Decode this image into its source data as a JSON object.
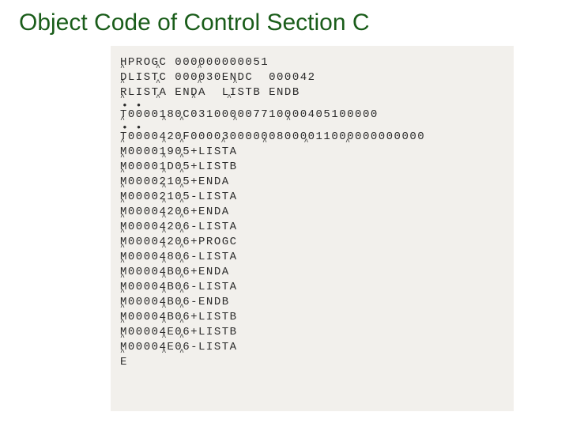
{
  "title": "Object Code of Control Section C",
  "lines": {
    "l1": {
      "text": "HPROGC 000000000051",
      "caret": "^     ^      ^"
    },
    "l2": {
      "text": "DLISTC 000030ENDC  000042",
      "caret": "^     ^      ^     ^"
    },
    "l3": {
      "text": "RLISTA ENDA  LISTB ENDB",
      "caret": "^     ^     ^     ^"
    },
    "l4": {
      "text": "T0000180C031000007710000405100000",
      "caret": "^      ^  ^        ^        ^"
    },
    "l5": {
      "text": "T0000420F000030000008000011000000000000",
      "caret": "^      ^  ^      ^      ^      ^      ^"
    },
    "l6": {
      "text": "M00001905+LISTA",
      "caret": "^      ^  ^"
    },
    "l7": {
      "text": "M00001D05+LISTB",
      "caret": "^      ^  ^"
    },
    "l8": {
      "text": "M00002105+ENDA",
      "caret": "^      ^  ^"
    },
    "l9": {
      "text": "M00002105-LISTA",
      "caret": "^      ^  ^"
    },
    "l10": {
      "text": "M00004206+ENDA",
      "caret": "^      ^  ^"
    },
    "l11": {
      "text": "M00004206-LISTA",
      "caret": "^      ^  ^"
    },
    "l12": {
      "text": "M00004206+PROGC",
      "caret": "^      ^  ^"
    },
    "l13": {
      "text": "M00004806-LISTA",
      "caret": "^      ^  ^"
    },
    "l14": {
      "text": "M00004B06+ENDA",
      "caret": "^      ^  ^"
    },
    "l15": {
      "text": "M00004B06-LISTA",
      "caret": "^      ^  ^"
    },
    "l16": {
      "text": "M00004B06-ENDB",
      "caret": "^      ^  ^"
    },
    "l17": {
      "text": "M00004B06+LISTB",
      "caret": "^      ^  ^"
    },
    "l18": {
      "text": "M00004E06+LISTB",
      "caret": "^      ^  ^"
    },
    "l19": {
      "text": "M00004E06-LISTA",
      "caret": "^      ^  ^"
    },
    "l20": {
      "text": "E",
      "caret": ""
    }
  },
  "dots": "• •"
}
